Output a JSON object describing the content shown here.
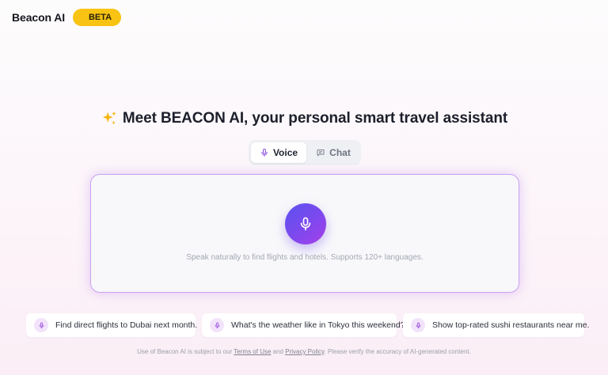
{
  "brand": {
    "name": "Beacon AI",
    "badge": "BETA",
    "badge_color": "#f8c313"
  },
  "hero": {
    "title": "Meet BEACON AI, your personal smart travel assistant",
    "icon": "sparkles-icon"
  },
  "tabs": [
    {
      "label": "Voice",
      "icon": "microphone-icon",
      "active": true
    },
    {
      "label": "Chat",
      "icon": "chat-bubble-icon",
      "active": false
    }
  ],
  "voice_panel": {
    "hint": "Speak naturally to find flights and hotels. Supports 120+ languages.",
    "mic_icon": "microphone-icon",
    "accent_gradient": [
      "#5b53f0",
      "#a53fe8"
    ]
  },
  "suggestions": [
    {
      "text": "Find direct flights to Dubai next month.",
      "icon": "microphone-icon"
    },
    {
      "text": "What's the weather like in Tokyo this weekend?",
      "icon": "microphone-icon"
    },
    {
      "text": "Show top-rated sushi restaurants near me.",
      "icon": "microphone-icon"
    }
  ],
  "footer": {
    "prefix": "Use of Beacon AI is subject to our ",
    "terms": "Terms of Use",
    "and": " and ",
    "privacy": "Privacy Policy",
    "suffix": ". Please verify the accuracy of AI-generated content."
  }
}
